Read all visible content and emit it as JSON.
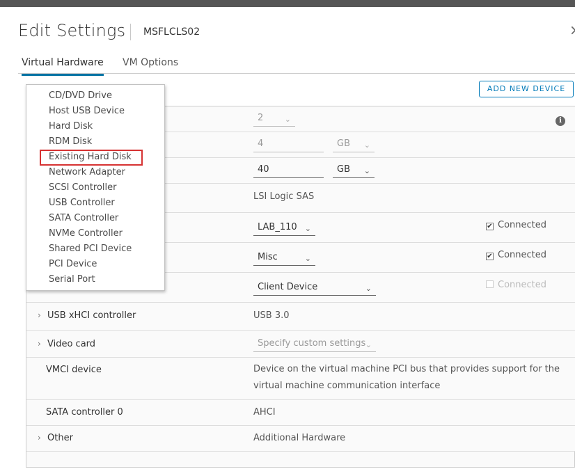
{
  "dialog": {
    "title": "Edit Settings",
    "vm_name": "MSFLCLS02",
    "close_glyph": "×"
  },
  "tabs": [
    {
      "label": "Virtual Hardware",
      "active": true
    },
    {
      "label": "VM Options",
      "active": false
    }
  ],
  "toolbar": {
    "add_new_device_label": "ADD NEW DEVICE"
  },
  "add_device_menu": {
    "items": [
      "CD/DVD Drive",
      "Host USB Device",
      "Hard Disk",
      "RDM Disk",
      "Existing Hard Disk",
      "Network Adapter",
      "SCSI Controller",
      "USB Controller",
      "SATA Controller",
      "NVMe Controller",
      "Shared PCI Device",
      "PCI Device",
      "Serial Port"
    ],
    "highlighted_item": "Existing Hard Disk"
  },
  "hardware": {
    "cpu": {
      "value": "2",
      "info_icon": "info-icon"
    },
    "memory": {
      "value": "4",
      "unit": "GB"
    },
    "hard_disk": {
      "value": "40",
      "unit": "GB"
    },
    "scsi_controller": {
      "value": "LSI Logic SAS"
    },
    "network_adapter_1": {
      "value": "LAB_110",
      "connected_label": "Connected",
      "connected": true
    },
    "network_adapter_2": {
      "value": "Misc",
      "connected_label": "Connected",
      "connected": true
    },
    "cd_dvd": {
      "value": "Client Device",
      "connected_label": "Connected",
      "connected": false
    },
    "usb_xhci": {
      "label": "USB xHCI controller",
      "value": "USB 3.0"
    },
    "video_card": {
      "label": "Video card",
      "value": "Specify custom settings"
    },
    "vmci": {
      "label": "VMCI device",
      "line1": "Device on the virtual machine PCI bus that provides support for the",
      "line2": "virtual machine communication interface"
    },
    "sata": {
      "label": "SATA controller 0",
      "value": "AHCI"
    },
    "other": {
      "label": "Other",
      "value": "Additional Hardware"
    }
  },
  "glyphs": {
    "chevron_right": "›",
    "caret_down": "⌄",
    "check": "✔"
  },
  "colors": {
    "accent": "#0079b8",
    "highlight_border": "#d63232"
  }
}
